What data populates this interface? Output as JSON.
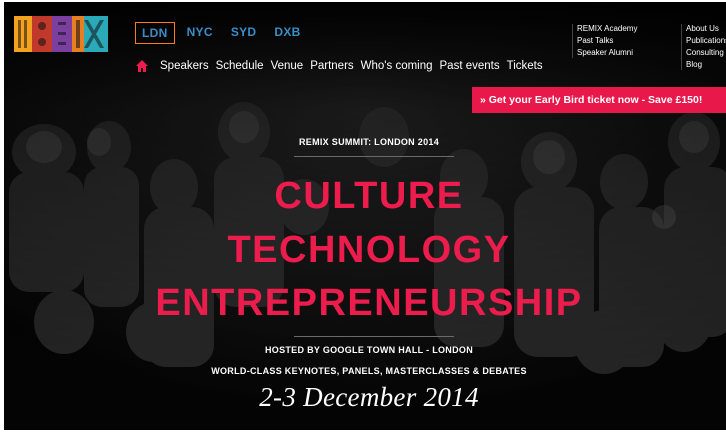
{
  "brand": {
    "logo_text": "REMIX",
    "accent_color": "#ec1c4d",
    "link_color": "#3a8dc6",
    "active_border_color": "#ff7a1a"
  },
  "city_nav": [
    {
      "label": "LDN",
      "active": true
    },
    {
      "label": "NYC",
      "active": false
    },
    {
      "label": "SYD",
      "active": false
    },
    {
      "label": "DXB",
      "active": false
    }
  ],
  "main_nav": {
    "home_icon": "home-icon",
    "items": [
      "Speakers",
      "Schedule",
      "Venue",
      "Partners",
      "Who's coming",
      "Past events",
      "Tickets"
    ]
  },
  "secondary_links_a": [
    "REMIX Academy",
    "Past Talks",
    "Speaker Alumni"
  ],
  "secondary_links_b": [
    "About Us",
    "Publications",
    "Consulting",
    "Blog"
  ],
  "cta": {
    "label": "» Get your Early Bird ticket now - Save £150!"
  },
  "hero": {
    "eyebrow": "REMIX SUMMIT: LONDON 2014",
    "headline_1": "CULTURE",
    "headline_2": "TECHNOLOGY",
    "headline_3": "ENTREPRENEURSHIP",
    "hosted": "HOSTED BY GOOGLE TOWN HALL - LONDON",
    "subline": "WORLD-CLASS KEYNOTES, PANELS, MASTERCLASSES & DEBATES",
    "date": "2-3 December 2014"
  }
}
